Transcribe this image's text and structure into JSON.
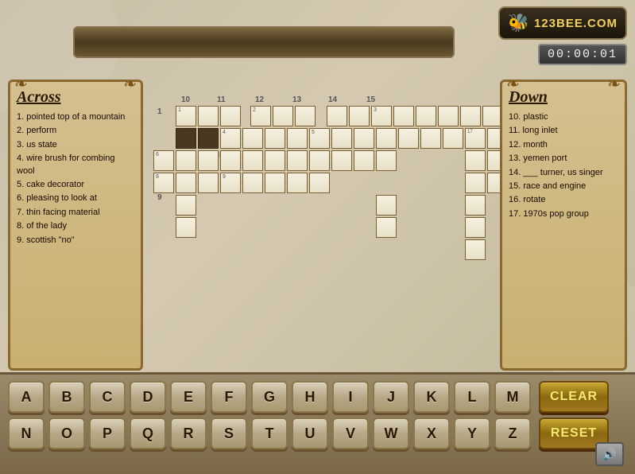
{
  "app": {
    "logo_text": "123BEE.COM",
    "logo_bee": "🐝",
    "timer": "00:00:01"
  },
  "clues_across": {
    "title": "Across",
    "items": [
      "1. pointed top of a mountain",
      "2. perform",
      "3. us state",
      "4. wire brush for combing wool",
      "5. cake decorator",
      "6. pleasing to look at",
      "7. thin facing material",
      "8. of the lady",
      "9. scottish \"no\""
    ]
  },
  "clues_down": {
    "title": "Down",
    "items": [
      "10. plastic",
      "11. long inlet",
      "12. month",
      "13. yemen port",
      "14. ___ turner, us singer",
      "15. race and engine",
      "16. rotate",
      "17. 1970s pop group"
    ]
  },
  "keyboard": {
    "row1": [
      "A",
      "B",
      "C",
      "D",
      "E",
      "F",
      "G",
      "H",
      "I",
      "J",
      "K",
      "L",
      "M"
    ],
    "row2": [
      "N",
      "O",
      "P",
      "Q",
      "R",
      "S",
      "T",
      "U",
      "V",
      "W",
      "X",
      "Y",
      "Z"
    ],
    "clear_label": "CLEAR",
    "reset_label": "RESET",
    "sound_icon": "🔊"
  }
}
